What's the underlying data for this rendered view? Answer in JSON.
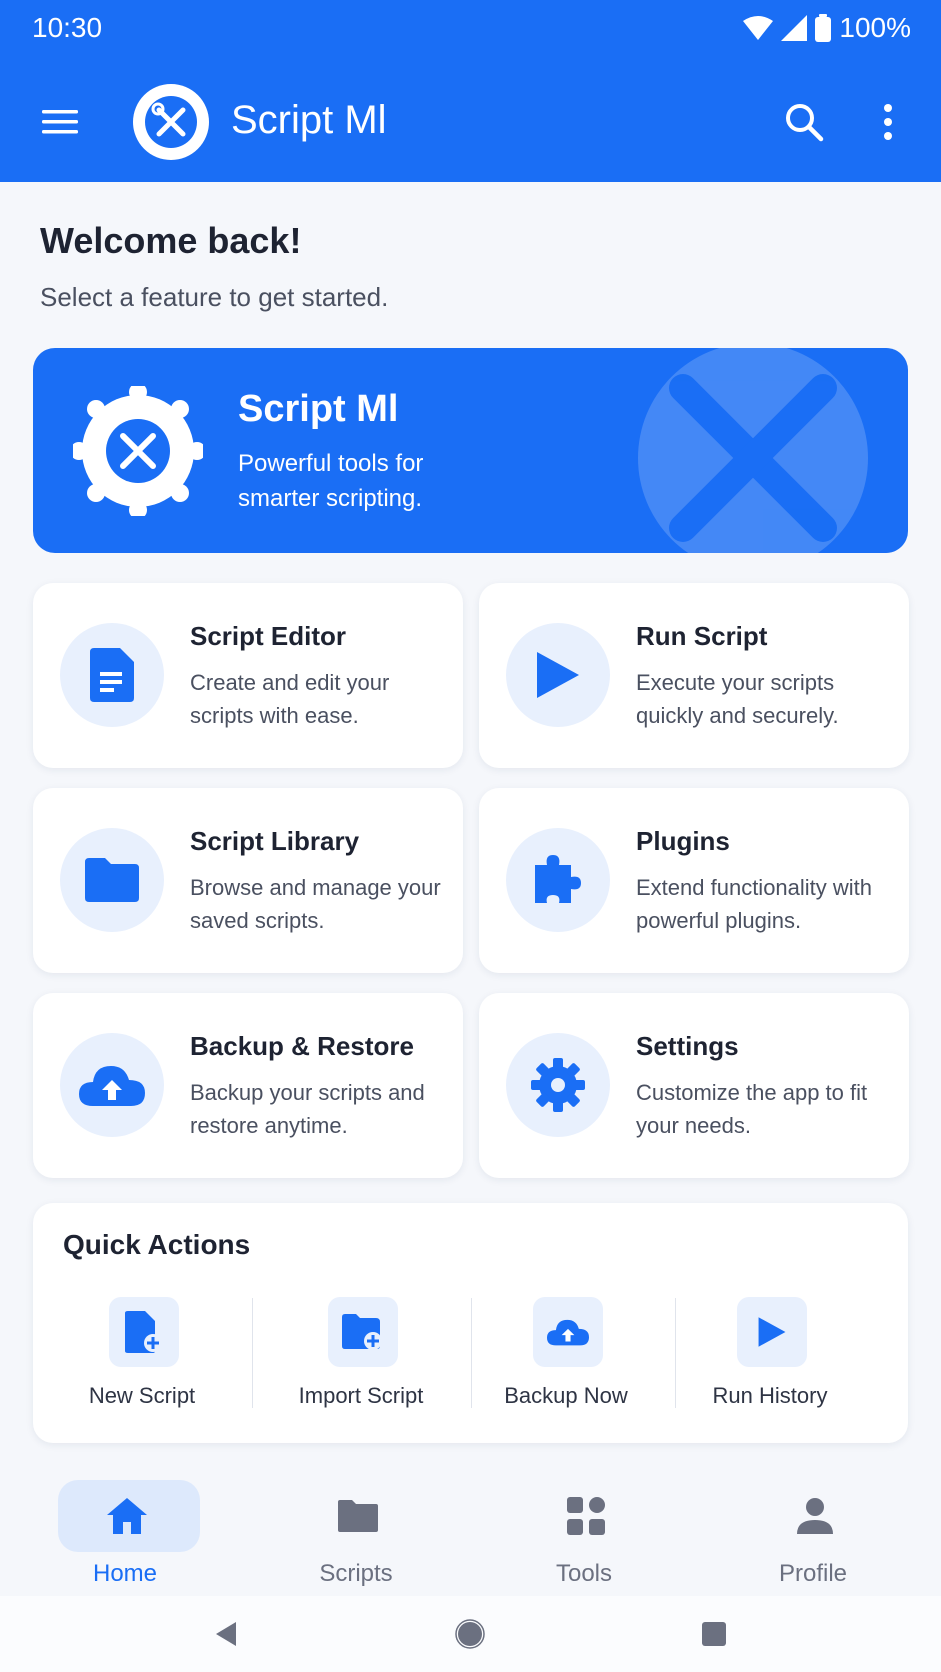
{
  "status_bar": {
    "time": "10:30",
    "battery": "100%"
  },
  "app_bar": {
    "title": "Script Ml",
    "icons": [
      "menu-icon",
      "search-icon",
      "more-vert-icon"
    ]
  },
  "welcome": {
    "title": "Welcome back!",
    "subtitle": "Select a feature to get started."
  },
  "hero": {
    "title": "Script Ml",
    "subtitle": "Powerful tools for smarter scripting."
  },
  "features": [
    {
      "title": "Script Editor",
      "desc": "Create and edit your scripts with ease.",
      "icon": "document-icon"
    },
    {
      "title": "Run Script",
      "desc": "Execute your scripts quickly and securely.",
      "icon": "play-icon"
    },
    {
      "title": "Script Library",
      "desc": "Browse and manage your saved scripts.",
      "icon": "folder-icon"
    },
    {
      "title": "Plugins",
      "desc": "Extend functionality with powerful plugins.",
      "icon": "puzzle-icon"
    },
    {
      "title": "Backup & Restore",
      "desc": "Backup your scripts and restore anytime.",
      "icon": "cloud-upload-icon"
    },
    {
      "title": "Settings",
      "desc": "Customize the app to fit your needs.",
      "icon": "gear-icon"
    }
  ],
  "quick_actions": {
    "title": "Quick Actions",
    "items": [
      {
        "label": "New Script",
        "icon": "new-file-icon"
      },
      {
        "label": "Import Script",
        "icon": "folder-add-icon"
      },
      {
        "label": "Backup Now",
        "icon": "cloud-upload-icon"
      },
      {
        "label": "Run History",
        "icon": "play-icon"
      }
    ]
  },
  "bottom_nav": [
    {
      "label": "Home",
      "icon": "home-icon",
      "active": true
    },
    {
      "label": "Scripts",
      "icon": "folder-icon",
      "active": false
    },
    {
      "label": "Tools",
      "icon": "grid-icon",
      "active": false
    },
    {
      "label": "Profile",
      "icon": "person-icon",
      "active": false
    }
  ],
  "colors": {
    "primary": "#1a6ef5",
    "icon_bg": "#e8f0fd",
    "background": "#f5f7fb"
  }
}
